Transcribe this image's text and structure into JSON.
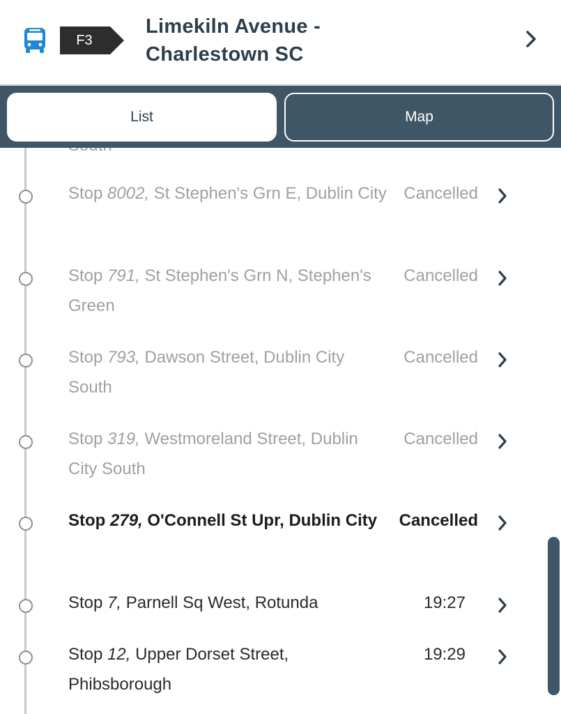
{
  "header": {
    "route_number": "F3",
    "title_line1": "Limekiln Avenue -",
    "title_line2": "Charlestown SC",
    "bus_icon": "bus-icon",
    "chevron_icon": "chevron-right-icon"
  },
  "tabs": [
    {
      "label": "List",
      "selected": true
    },
    {
      "label": "Map",
      "selected": false
    }
  ],
  "clipped_text": "South",
  "stops": [
    {
      "prefix": "Stop",
      "number": "8002,",
      "name": "St Stephen's Grn E, Dublin City",
      "status": "Cancelled"
    },
    {
      "prefix": "Stop",
      "number": "791,",
      "name": "St Stephen's Grn N, Stephen's Green",
      "status": "Cancelled"
    },
    {
      "prefix": "Stop",
      "number": "793,",
      "name": "Dawson Street, Dublin City South",
      "status": "Cancelled"
    },
    {
      "prefix": "Stop",
      "number": "319,",
      "name": "Westmoreland Street, Dublin City South",
      "status": "Cancelled"
    },
    {
      "prefix": "Stop",
      "number": "279,",
      "name": "O'Connell St Upr, Dublin City",
      "status": "Cancelled"
    },
    {
      "prefix": "Stop",
      "number": "7,",
      "name": "Parnell Sq West, Rotunda",
      "status": "19:27"
    },
    {
      "prefix": "Stop",
      "number": "12,",
      "name": "Upper Dorset Street, Phibsborough",
      "status": "19:29"
    }
  ],
  "colors": {
    "header_bg": "#ffffff",
    "tabbar_bg": "#3f5666",
    "route_badge": "#2d2d2d",
    "bus_icon": "#1e88d6",
    "cancelled_text": "#a0a0a0",
    "active_text": "#1c1c1c"
  }
}
